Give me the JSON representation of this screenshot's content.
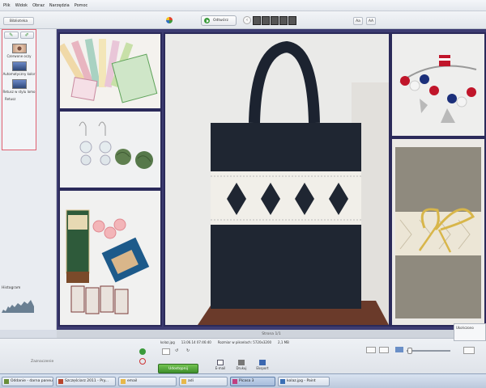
{
  "menu": [
    "Plik",
    "Widok",
    "Obraz",
    "Narzędzia",
    "Pomoc"
  ],
  "toolbar": {
    "back_label": "Biblioteka",
    "play_label": "Odtwórz",
    "text_buttons": [
      "Aa",
      "AA"
    ]
  },
  "sidebar": {
    "fix_items": [
      {
        "label": "Czerwone oczy"
      },
      {
        "label": "Automatyczny kolor"
      },
      {
        "label": "Retusz w stylu lomo"
      }
    ],
    "small_label": "Retusz",
    "histogram_label": "Histogram"
  },
  "photos": [
    {
      "desc": "papierki"
    },
    {
      "desc": "kolczyki"
    },
    {
      "desc": "czekolada"
    },
    {
      "desc": "torba"
    },
    {
      "desc": "bransoletka"
    },
    {
      "desc": "notes"
    }
  ],
  "status_line": "Strona 1/1",
  "bottom": {
    "fileinfo": [
      "kolaz.jpg",
      "13.06.14 07:46:40",
      "Rozmiar w pikselach: 5720x3200",
      "2,1 MB"
    ],
    "share_label": "Udostępnij",
    "actions": [
      "E-mail",
      "Drukuj",
      "Eksport"
    ],
    "left_label": "Zaznaczenie"
  },
  "toast": "Ukończono",
  "taskbar": [
    {
      "label": "Oddanie - darna paneu",
      "color": "#6a8f3a"
    },
    {
      "label": "Szczęściarz 2011 - Pry...",
      "color": "#b8452b"
    },
    {
      "label": "email",
      "color": "#e7b84a"
    },
    {
      "label": "adi",
      "color": "#e7b84a"
    },
    {
      "label": "Picasa 3",
      "color": "#c04080",
      "active": true
    },
    {
      "label": "kolaz.jpg - Paint",
      "color": "#3a6fb5"
    }
  ],
  "colors": {
    "frame": "#3d3c72",
    "fix_border": "#e06070",
    "share": "#4f9f35"
  }
}
